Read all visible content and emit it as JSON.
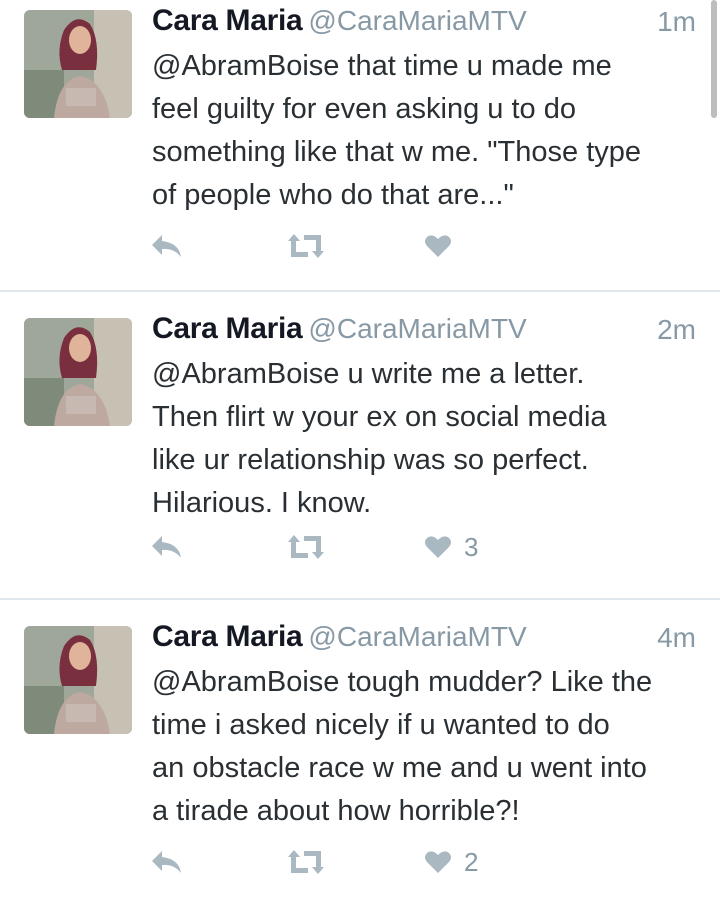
{
  "tweets": [
    {
      "name": "Cara Maria",
      "handle": "@CaraMariaMTV",
      "time": "1m",
      "lines": [
        "@AbramBoise that time u made me",
        "feel guilty for even asking u to do",
        "something like that w me. \"Those type",
        "of people who do that are...\""
      ],
      "likes": ""
    },
    {
      "name": "Cara Maria",
      "handle": "@CaraMariaMTV",
      "time": "2m",
      "lines": [
        "@AbramBoise u write me a letter.",
        "Then flirt w your ex on social media",
        "like ur relationship was so perfect.",
        "Hilarious. I know."
      ],
      "likes": "3"
    },
    {
      "name": "Cara Maria",
      "handle": "@CaraMariaMTV",
      "time": "4m",
      "lines": [
        "@AbramBoise tough mudder? Like the",
        "time i asked nicely if u wanted to do",
        "an obstacle race w me and u went into",
        "a tirade about how horrible?!"
      ],
      "likes": "2"
    }
  ],
  "icons": {
    "reply": "reply-icon",
    "retweet": "retweet-icon",
    "like": "heart-icon"
  },
  "colors": {
    "icon_gray": "#aab8c2",
    "meta_gray": "#8899a6",
    "divider": "#e1e8ed"
  }
}
